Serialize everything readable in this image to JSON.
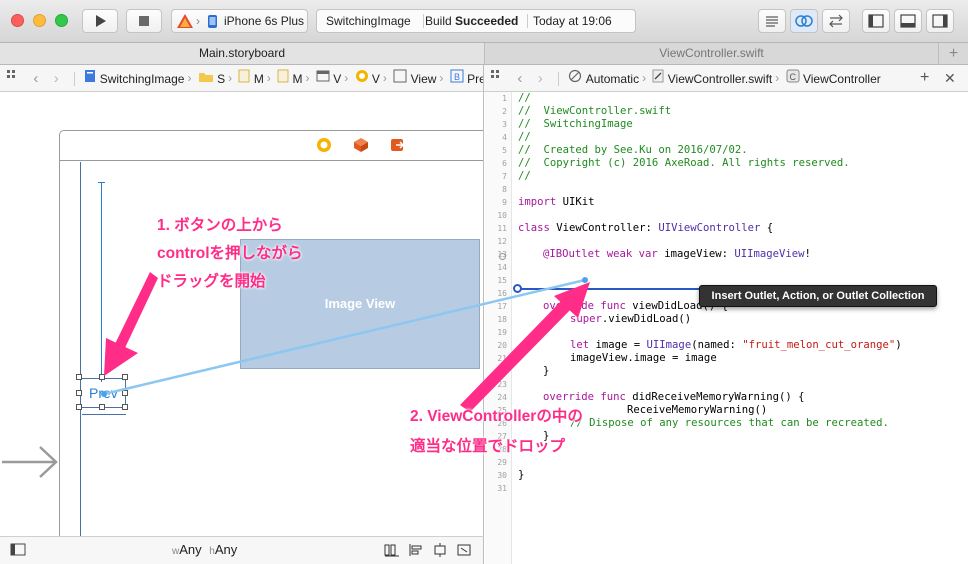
{
  "toolbar": {
    "scheme": "",
    "device": "iPhone 6s Plus",
    "project": "SwitchingImage",
    "build_prefix": "Build",
    "build_status": "Succeeded",
    "timestamp": "Today at 19:06"
  },
  "tabs": [
    {
      "label": "Main.storyboard"
    },
    {
      "label": "ViewController.swift"
    }
  ],
  "left_jump": {
    "items": [
      "SwitchingImage",
      "S",
      "M",
      "M",
      "V",
      "V",
      "V",
      "View",
      "Prev"
    ]
  },
  "right_jump": {
    "mode": "Automatic",
    "file": "ViewController.swift",
    "class": "ViewController"
  },
  "canvas": {
    "image_view_label": "Image View",
    "button_label": "Prev"
  },
  "popover": {
    "label": "Insert Outlet, Action, or Outlet Collection"
  },
  "annotations": {
    "step1_line1": "1. ボタンの上から",
    "step1_line2": "controlを押しながら",
    "step1_line3": "ドラッグを開始",
    "step2_line1": "2. ViewControllerの中の",
    "step2_line2": "適当な位置でドロップ"
  },
  "bottombar": {
    "w_prefix": "w",
    "w_value": "Any",
    "h_prefix": "h",
    "h_value": "Any"
  },
  "code": {
    "line_numbers": [
      "1",
      "2",
      "3",
      "4",
      "5",
      "6",
      "7",
      "8",
      "9",
      "10",
      "11",
      "12",
      "13",
      "14",
      "15",
      "16",
      "17",
      "18",
      "19",
      "20",
      "21",
      "22",
      "23",
      "24",
      "25",
      "26",
      "27",
      "28",
      "29",
      "30",
      "31"
    ],
    "lines": [
      {
        "n": "1",
        "text": "//"
      },
      {
        "n": "2",
        "text": "//  ViewController.swift"
      },
      {
        "n": "3",
        "text": "//  SwitchingImage"
      },
      {
        "n": "4",
        "text": "//"
      },
      {
        "n": "5",
        "text": "//  Created by See.Ku on 2016/07/02."
      },
      {
        "n": "6",
        "text": "//  Copyright (c) 2016 AxeRoad. All rights reserved."
      },
      {
        "n": "7",
        "text": "//"
      },
      {
        "n": "9",
        "kw": "import",
        "rest": " UIKit"
      },
      {
        "n": "11",
        "kw": "class",
        "mid": " ViewController: ",
        "ty": "UIViewController",
        "rest": " {"
      },
      {
        "n": "13",
        "kw": "@IBOutlet weak var",
        "mid": " imageView: ",
        "ty": "UIImageView",
        "rest": "!"
      },
      {
        "n": "17",
        "kw": "override func",
        "rest": " viewDidLoad() {"
      },
      {
        "n": "18",
        "kw": "super",
        "rest": ".viewDidLoad()"
      },
      {
        "n": "20",
        "kw": "let",
        "mid": " image = ",
        "ty": "UIImage",
        "rest": "(named: ",
        "st": "\"fruit_melon_cut_orange\"",
        "end": ")"
      },
      {
        "n": "21",
        "text": "imageView.image = image"
      },
      {
        "n": "22",
        "text": "}"
      },
      {
        "n": "24",
        "kw": "override func",
        "rest": " didReceiveMemoryWarning() {"
      },
      {
        "n": "25",
        "rest": "ReceiveMemoryWarning()"
      },
      {
        "n": "26",
        "text": "// Dispose of any resources that can be recreated."
      },
      {
        "n": "27",
        "text": "}"
      },
      {
        "n": "30",
        "text": "}"
      }
    ]
  },
  "colors": {
    "accent_pink": "#ff2d87",
    "image_view_fill": "#b7cbe2",
    "link_blue": "#2a7fd4",
    "build_succeeded": "#222222"
  }
}
